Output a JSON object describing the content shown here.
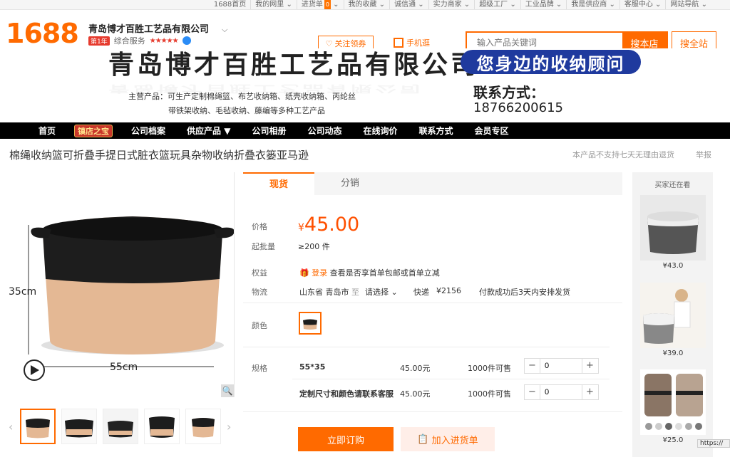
{
  "topbar": {
    "items": [
      "1688首页",
      "我的网里",
      "进货单",
      "我的收藏",
      "诚信通",
      "实力商家",
      "超级工厂",
      "工业品牌",
      "我是供应商",
      "客服中心",
      "网站导航"
    ],
    "cart_count": "0"
  },
  "header": {
    "logo": "1688",
    "shop_name": "青岛博才百胜工艺品有限公司",
    "year_badge": "第1年",
    "rating_label": "综合服务",
    "stars": "★★★★★",
    "follow_label": "关注领券",
    "mobile_label": "手机逛",
    "search_placeholder": "输入产品关键词",
    "search_store_label": "搜本店",
    "search_all_label": "搜全站"
  },
  "banner": {
    "company": "青岛博才百胜工艺品有限公司",
    "slogan": "您身边的收纳顾问",
    "products_line1": "主营产品：可生产定制棉绳篮、布艺收纳箱、纸壳收纳箱、丙纶丝",
    "products_line2": "带铁架收纳、毛毡收纳、藤编等多种工艺产品",
    "contact_label": "联系方式：",
    "phone": "18766200615"
  },
  "nav": {
    "items": [
      "首页",
      "镇店之宝",
      "公司档案",
      "供应产品 ▼",
      "公司相册",
      "公司动态",
      "在线询价",
      "联系方式",
      "会员专区"
    ]
  },
  "product": {
    "title": "棉绳收纳篮可折叠手提日式脏衣篮玩具杂物收纳折叠衣篓亚马逊",
    "returns_note": "本产品不支持七天无理由退货",
    "report_label": "举报",
    "dim_height": "35cm",
    "dim_width": "55cm"
  },
  "tabs": [
    "现货",
    "分销"
  ],
  "details": {
    "price_label": "价格",
    "currency": "¥",
    "price": "45.00",
    "moq_label": "起批量",
    "moq": "≥200 件",
    "benefit_label": "权益",
    "login_label": "登录",
    "benefit_text": "查看是否享首单包邮或首单立减",
    "logistics_label": "物流",
    "from": "山东省 青岛市",
    "to_label": "至",
    "select_label": "请选择",
    "express": "快递",
    "shipping_price": "¥2156",
    "dispatch": "付款成功后3天内安排发货",
    "color_label": "颜色",
    "spec_label": "规格"
  },
  "specs": [
    {
      "name": "55*35",
      "price": "45.00元",
      "stock": "1000件可售",
      "qty": "0"
    },
    {
      "name": "定制尺寸和颜色请联系客服",
      "price": "45.00元",
      "stock": "1000件可售",
      "qty": "0"
    }
  ],
  "actions": {
    "order_label": "立即订购",
    "cart_label": "加入进货单"
  },
  "side": {
    "title": "买家还在看",
    "items": [
      {
        "price": "¥43.0"
      },
      {
        "price": "¥39.0"
      },
      {
        "price": "¥25.0"
      }
    ]
  },
  "status_url": "https://"
}
